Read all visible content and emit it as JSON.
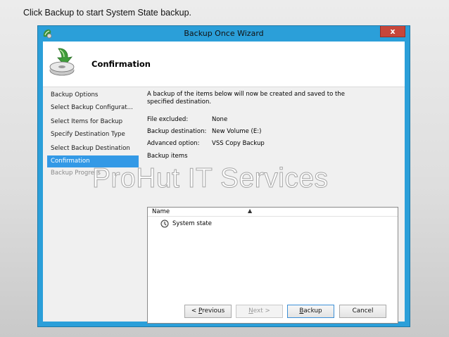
{
  "slide": {
    "caption": "Click Backup to start System State backup."
  },
  "window": {
    "title": "Backup Once Wizard",
    "close_label": "x"
  },
  "header": {
    "title": "Confirmation"
  },
  "nav": {
    "items": [
      {
        "label": "Backup Options",
        "state": "normal"
      },
      {
        "label": "Select Backup Configurat...",
        "state": "normal"
      },
      {
        "label": "Select Items for Backup",
        "state": "normal"
      },
      {
        "label": "Specify Destination Type",
        "state": "normal"
      },
      {
        "label": "Select Backup Destination",
        "state": "normal"
      },
      {
        "label": "Confirmation",
        "state": "selected"
      },
      {
        "label": "Backup Progress",
        "state": "disabled"
      }
    ]
  },
  "content": {
    "intro": "A backup of the items below will now be created and saved to the specified destination.",
    "properties": [
      {
        "label": "File excluded:",
        "value": "None"
      },
      {
        "label": "Backup destination:",
        "value": "New Volume (E:)"
      },
      {
        "label": "Advanced option:",
        "value": "VSS Copy Backup"
      }
    ],
    "items_label": "Backup items",
    "list": {
      "column_name": "Name",
      "rows": [
        {
          "name": "System state"
        }
      ]
    }
  },
  "buttons": {
    "previous_prefix": "< ",
    "previous_mnemonic": "P",
    "previous_rest": "revious",
    "next_mnemonic": "N",
    "next_rest": "ext >",
    "backup_mnemonic": "B",
    "backup_rest": "ackup",
    "cancel_label": "Cancel"
  },
  "watermark": {
    "text": "ProHut IT Services"
  },
  "colors": {
    "window_frame": "#2b9fd9",
    "selected_nav": "#3399e6",
    "close_button": "#c7463a"
  }
}
